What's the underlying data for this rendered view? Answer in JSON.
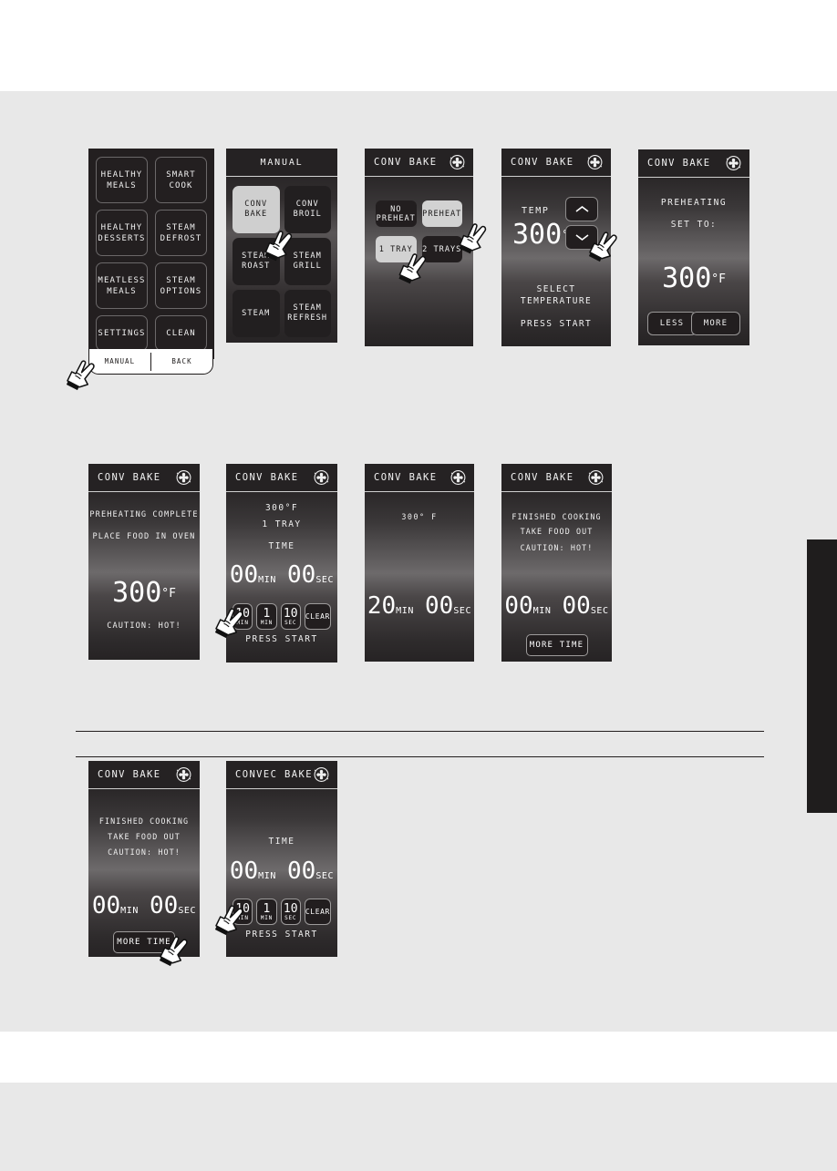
{
  "theme": {
    "page_bg": "#e8e8e8",
    "panel_bg": "#232021",
    "selected_bg": "#cfcfcf",
    "text": "#f2f2f2"
  },
  "side_tab": {
    "label": ""
  },
  "panels": {
    "menu": {
      "buttons": [
        "HEALTHY\nMEALS",
        "SMART\nCOOK",
        "HEALTHY\nDESSERTS",
        "STEAM\nDEFROST",
        "MEATLESS\nMEALS",
        "STEAM\nOPTIONS",
        "SETTINGS",
        "CLEAN"
      ],
      "bottom_bar": {
        "left": "MANUAL",
        "right": "BACK"
      }
    },
    "manual": {
      "title": "MANUAL",
      "buttons": [
        {
          "label": "CONV\nBAKE",
          "selected": true
        },
        {
          "label": "CONV\nBROIL",
          "selected": false
        },
        {
          "label": "STEAM\nROAST",
          "selected": false
        },
        {
          "label": "STEAM\nGRILL",
          "selected": false
        },
        {
          "label": "STEAM",
          "selected": false
        },
        {
          "label": "STEAM\nREFRESH",
          "selected": false
        }
      ]
    },
    "options": {
      "title": "CONV BAKE",
      "icon": "fan-icon",
      "buttons": [
        {
          "label": "NO\nPREHEAT",
          "selected": false
        },
        {
          "label": "PREHEAT",
          "selected": true
        },
        {
          "label": "1 TRAY",
          "selected": true
        },
        {
          "label": "2 TRAYS",
          "selected": false
        }
      ]
    },
    "temperature": {
      "title": "CONV BAKE",
      "icon": "fan-icon",
      "temp_label": "TEMP",
      "temp_value": "300",
      "temp_unit": "°F",
      "up_icon": "chevron-up-icon",
      "down_icon": "chevron-down-icon",
      "instruction": "SELECT\nTEMPERATURE",
      "press_start": "PRESS START"
    },
    "preheating": {
      "title": "CONV BAKE",
      "icon": "fan-icon",
      "line1": "PREHEATING",
      "line2": "SET TO:",
      "temp_value": "300",
      "temp_unit": "°F",
      "less_label": "LESS",
      "more_label": "MORE"
    },
    "preheat_complete": {
      "title": "CONV BAKE",
      "icon": "fan-icon",
      "line1": "PREHEATING COMPLETE",
      "line2": "PLACE FOOD IN OVEN",
      "temp_value": "300",
      "temp_unit": "°F",
      "caution": "CAUTION: HOT!"
    },
    "set_time": {
      "title": "CONV BAKE",
      "icon": "fan-icon",
      "line1": "300°F",
      "line2": "1 TRAY",
      "time_label": "TIME",
      "minutes": "00",
      "min_suffix": "MIN",
      "seconds": "00",
      "sec_suffix": "SEC",
      "pad": [
        {
          "n": "10",
          "u": "MIN"
        },
        {
          "n": "1",
          "u": "MIN"
        },
        {
          "n": "10",
          "u": "SEC"
        }
      ],
      "clear_label": "CLEAR",
      "press_start": "PRESS START"
    },
    "cooking": {
      "title": "CONV BAKE",
      "icon": "fan-icon",
      "line1": "300° F",
      "minutes": "20",
      "min_suffix": "MIN",
      "seconds": "00",
      "sec_suffix": "SEC"
    },
    "finished_a": {
      "title": "CONV BAKE",
      "icon": "fan-icon",
      "line1": "FINISHED COOKING",
      "line2": "TAKE FOOD OUT",
      "line3": "CAUTION: HOT!",
      "minutes": "00",
      "min_suffix": "MIN",
      "seconds": "00",
      "sec_suffix": "SEC",
      "more_time": "MORE TIME"
    },
    "finished_b": {
      "title": "CONV BAKE",
      "icon": "fan-icon",
      "line1": "FINISHED COOKING",
      "line2": "TAKE FOOD OUT",
      "line3": "CAUTION: HOT!",
      "minutes": "00",
      "min_suffix": "MIN",
      "seconds": "00",
      "sec_suffix": "SEC",
      "more_time": "MORE TIME"
    },
    "convec_time": {
      "title": "CONVEC BAKE",
      "icon": "fan-icon",
      "time_label": "TIME",
      "minutes": "00",
      "min_suffix": "MIN",
      "seconds": "00",
      "sec_suffix": "SEC",
      "pad": [
        {
          "n": "10",
          "u": "MIN"
        },
        {
          "n": "1",
          "u": "MIN"
        },
        {
          "n": "10",
          "u": "SEC"
        }
      ],
      "clear_label": "CLEAR",
      "press_start": "PRESS START"
    }
  }
}
